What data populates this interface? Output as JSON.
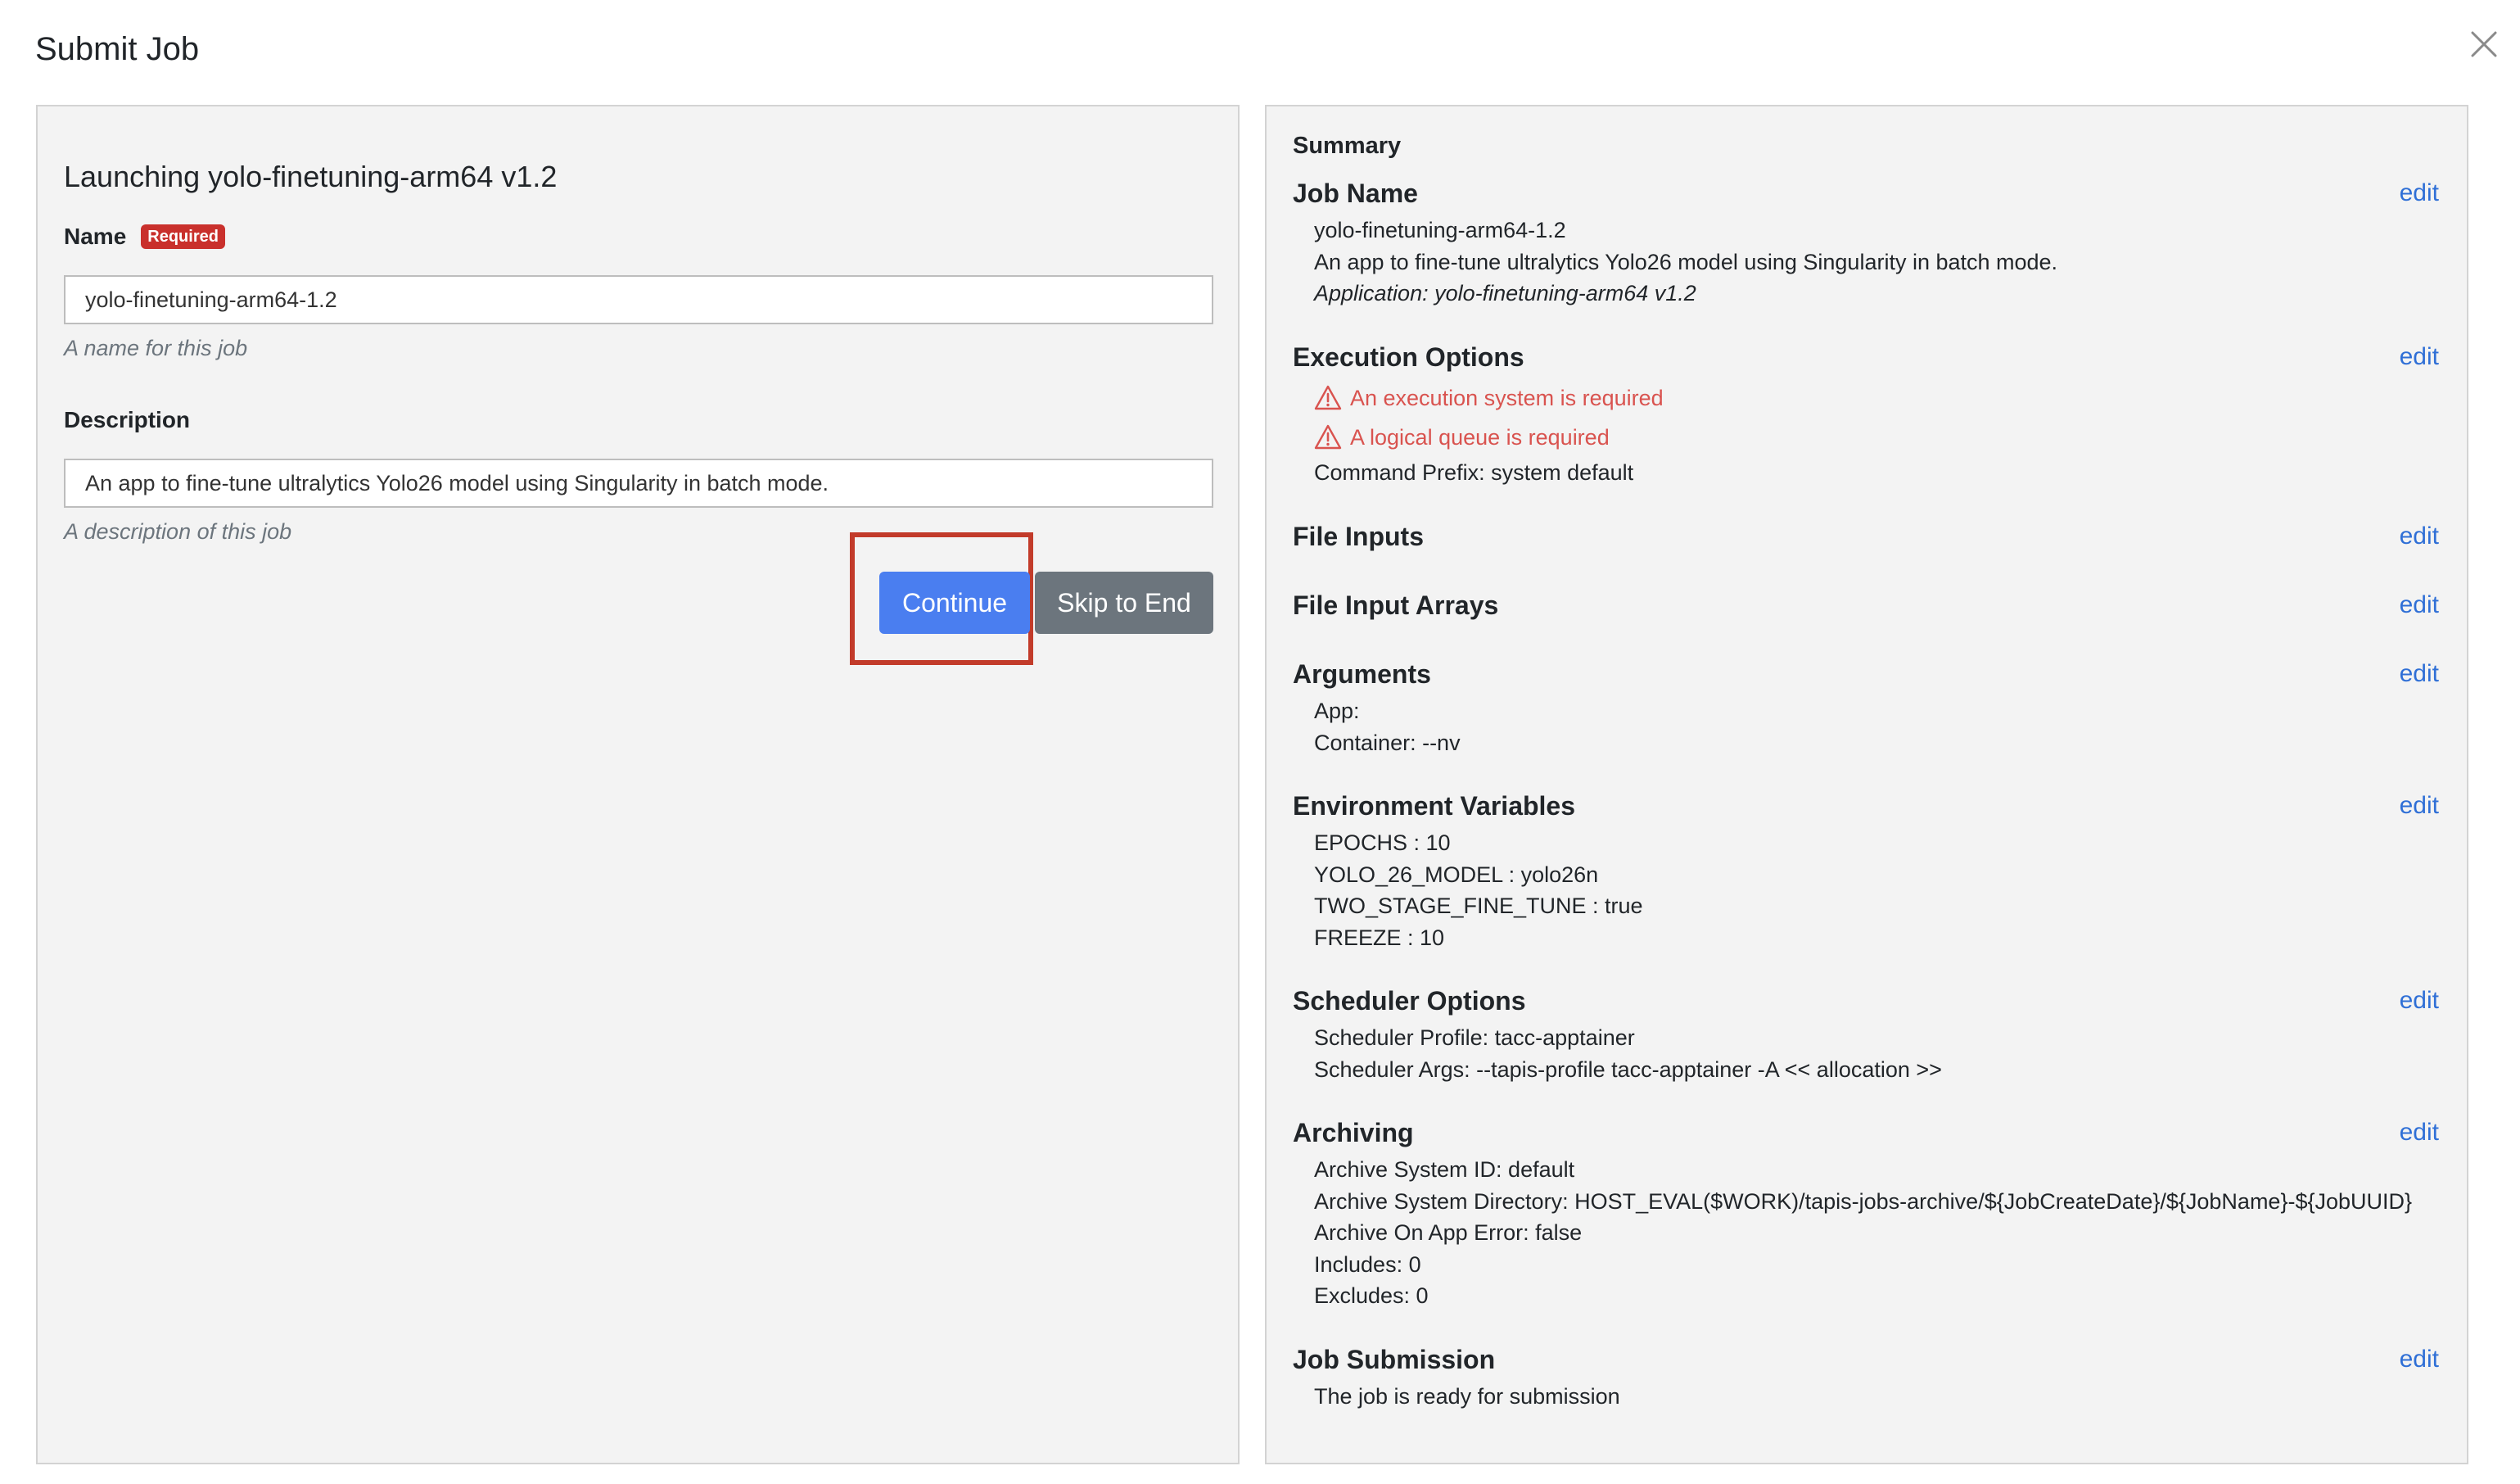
{
  "modal": {
    "title": "Submit Job"
  },
  "form": {
    "launch_title": "Launching yolo-finetuning-arm64 v1.2",
    "name": {
      "label": "Name",
      "badge": "Required",
      "value": "yolo-finetuning-arm64-1.2",
      "help": "A name for this job"
    },
    "description": {
      "label": "Description",
      "value": "An app to fine-tune ultralytics Yolo26 model using Singularity in batch mode.",
      "help": "A description of this job"
    },
    "buttons": {
      "continue": "Continue",
      "skip": "Skip to End"
    }
  },
  "summary": {
    "label": "Summary",
    "edit_label": "edit",
    "job_name": {
      "title": "Job Name",
      "lines": [
        "yolo-finetuning-arm64-1.2",
        "An app to fine-tune ultralytics Yolo26 model using Singularity in batch mode.",
        "Application: yolo-finetuning-arm64 v1.2"
      ]
    },
    "execution_options": {
      "title": "Execution Options",
      "warnings": [
        "An execution system is required",
        "A logical queue is required"
      ],
      "lines": [
        "Command Prefix: system default"
      ],
      "warning_color": "#d9534f"
    },
    "file_inputs": {
      "title": "File Inputs"
    },
    "file_input_arrays": {
      "title": "File Input Arrays"
    },
    "arguments": {
      "title": "Arguments",
      "lines": [
        "App:",
        "Container: --nv"
      ]
    },
    "environment_variables": {
      "title": "Environment Variables",
      "lines": [
        "EPOCHS : 10",
        "YOLO_26_MODEL : yolo26n",
        "TWO_STAGE_FINE_TUNE : true",
        "FREEZE : 10"
      ]
    },
    "scheduler_options": {
      "title": "Scheduler Options",
      "lines": [
        "Scheduler Profile: tacc-apptainer",
        "Scheduler Args: --tapis-profile tacc-apptainer -A << allocation >>"
      ]
    },
    "archiving": {
      "title": "Archiving",
      "lines": [
        "Archive System ID: default",
        "Archive System Directory: HOST_EVAL($WORK)/tapis-jobs-archive/${JobCreateDate}/${JobName}-${JobUUID}",
        "Archive On App Error: false",
        "Includes: 0",
        "Excludes: 0"
      ]
    },
    "job_submission": {
      "title": "Job Submission",
      "lines": [
        "The job is ready for submission"
      ]
    }
  },
  "colors": {
    "primary": "#4a7ef0",
    "secondary": "#6c757d",
    "danger": "#c9302c",
    "highlight": "#c23b2a",
    "link": "#2f6fd6"
  }
}
